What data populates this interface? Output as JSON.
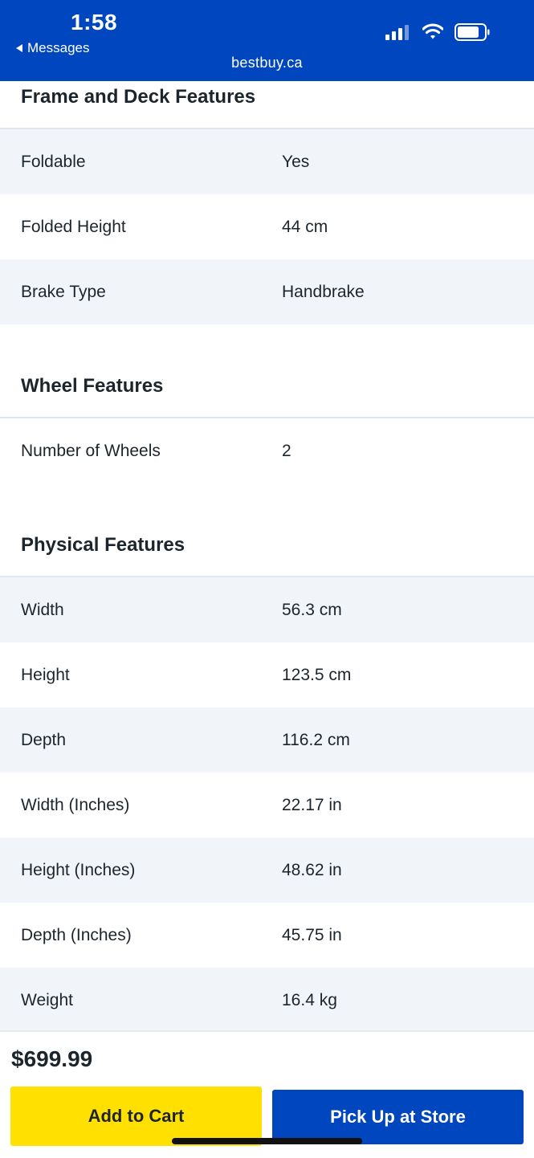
{
  "status_bar": {
    "time": "1:58",
    "back_label": "Messages",
    "url": "bestbuy.ca"
  },
  "sections": {
    "frame": {
      "title": "Frame and Deck Features",
      "rows": [
        {
          "label": "Foldable",
          "value": "Yes"
        },
        {
          "label": "Folded Height",
          "value": "44 cm"
        },
        {
          "label": "Brake Type",
          "value": "Handbrake"
        }
      ]
    },
    "wheel": {
      "title": "Wheel Features",
      "rows": [
        {
          "label": "Number of Wheels",
          "value": "2"
        }
      ]
    },
    "physical": {
      "title": "Physical Features",
      "rows": [
        {
          "label": "Width",
          "value": "56.3 cm"
        },
        {
          "label": "Height",
          "value": "123.5 cm"
        },
        {
          "label": "Depth",
          "value": "116.2 cm"
        },
        {
          "label": "Width (Inches)",
          "value": "22.17 in"
        },
        {
          "label": "Height (Inches)",
          "value": "48.62 in"
        },
        {
          "label": "Depth (Inches)",
          "value": "45.75 in"
        },
        {
          "label": "Weight",
          "value": "16.4 kg"
        }
      ]
    }
  },
  "purchase": {
    "price": "$699.99",
    "add_to_cart_label": "Add to Cart",
    "pickup_label": "Pick Up at Store"
  },
  "colors": {
    "brand_blue": "#0046be",
    "cart_yellow": "#ffe000",
    "row_shade": "#f1f4f9"
  }
}
